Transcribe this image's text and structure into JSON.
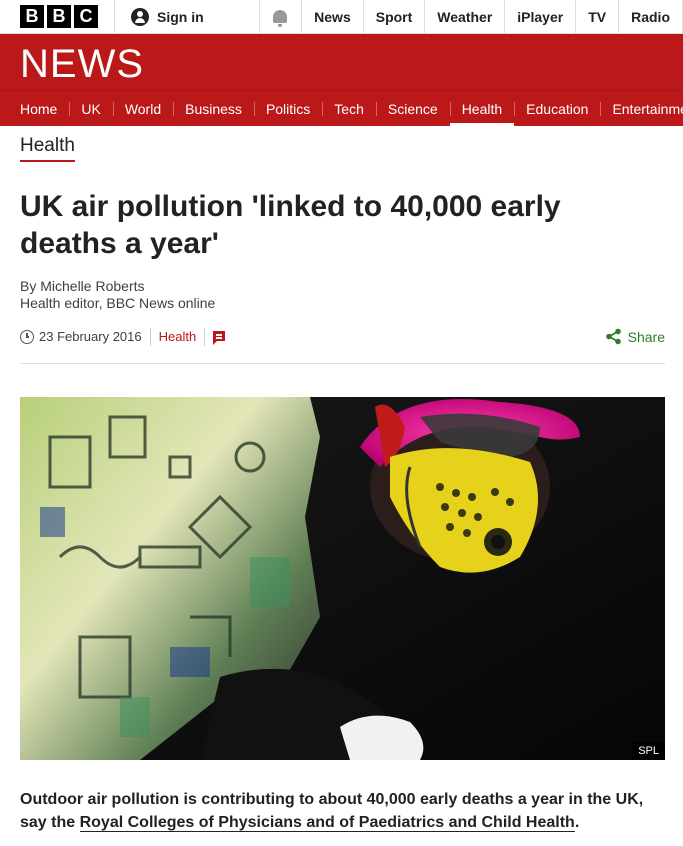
{
  "topbar": {
    "logo_letters": [
      "B",
      "B",
      "C"
    ],
    "signin_label": "Sign in",
    "nav": [
      "News",
      "Sport",
      "Weather",
      "iPlayer",
      "TV",
      "Radio"
    ]
  },
  "banner": {
    "title": "NEWS"
  },
  "section_nav": {
    "items": [
      "Home",
      "UK",
      "World",
      "Business",
      "Politics",
      "Tech",
      "Science",
      "Health",
      "Education",
      "Entertainment"
    ],
    "active": "Health"
  },
  "article": {
    "section": "Health",
    "headline": "UK air pollution 'linked to 40,000 early deaths a year'",
    "author": "By Michelle Roberts",
    "author_role": "Health editor, BBC News online",
    "date": "23 February 2016",
    "tag": "Health",
    "share_label": "Share",
    "image_credit": "SPL",
    "intro_text": "Outdoor air pollution is contributing to about 40,000 early deaths a year in the UK, say the ",
    "intro_link": "Royal Colleges of Physicians and of Paediatrics and Child Health",
    "intro_end": "."
  },
  "colors": {
    "brand_red": "#bb1919",
    "share_green": "#2a7d2a"
  },
  "icons": {
    "user": "user-icon",
    "notifications": "bell-icon",
    "clock": "clock-icon",
    "comments": "comment-icon",
    "share": "share-icon"
  }
}
